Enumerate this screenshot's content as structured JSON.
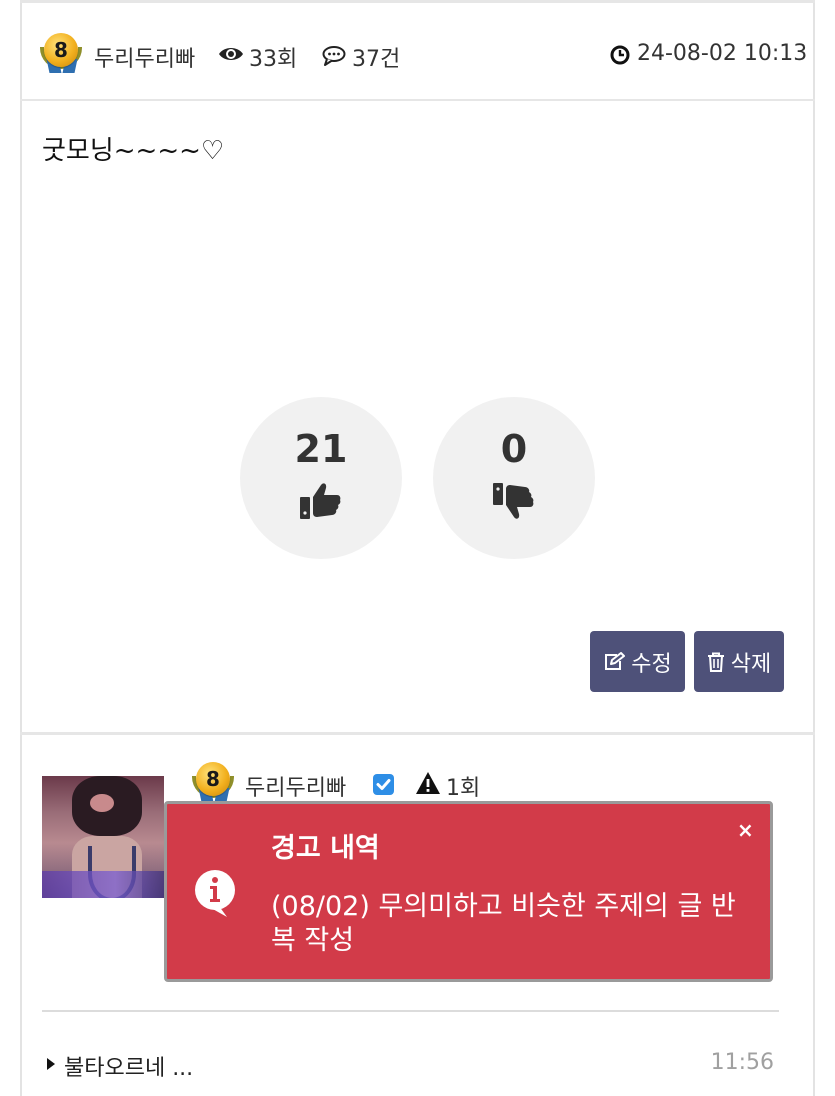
{
  "post": {
    "author": "두리두리빠",
    "level_badge": "8",
    "views": "33회",
    "comments": "37건",
    "datetime": "24-08-02 10:13",
    "body": "굿모닝~~~~♡"
  },
  "votes": {
    "likes": "21",
    "dislikes": "0"
  },
  "actions": {
    "edit_label": "수정",
    "delete_label": "삭제"
  },
  "comment_author": {
    "name": "두리두리빠",
    "level_badge": "8",
    "warning_count": "1회"
  },
  "alert": {
    "title": "경고 내역",
    "message": "(08/02) 무의미하고 비슷한 주제의 글 반복 작성",
    "close": "×"
  },
  "reply": {
    "text": "불타오르네 ...",
    "time": "11:56"
  },
  "colors": {
    "button_bg": "#4e5179",
    "alert_bg": "#d23b49",
    "checkbox": "#2e8ee6"
  },
  "icons": [
    "eye-icon",
    "comment-icon",
    "clock-icon",
    "thumbs-up-icon",
    "thumbs-down-icon",
    "edit-icon",
    "trash-icon",
    "check-icon",
    "warning-icon",
    "info-icon",
    "caret-right-icon"
  ]
}
